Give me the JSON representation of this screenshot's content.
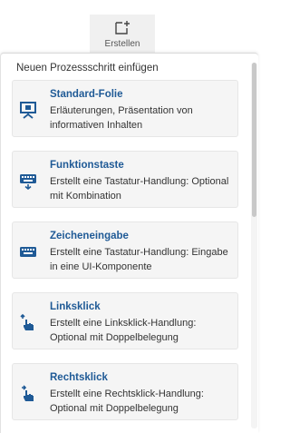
{
  "toolbar": {
    "create_label": "Erstellen",
    "create_icon": "add-slide-icon"
  },
  "panel": {
    "title": "Neuen Prozessschritt einfügen",
    "accent_color": "#1f5a96",
    "items": [
      {
        "title": "Standard-Folie",
        "description": "Erläuterungen, Präsentation von informativen Inhalten",
        "icon": "presentation-icon"
      },
      {
        "title": "Funktionstaste",
        "description": "Erstellt eine Tastatur-Handlung: Optional mit Kombination",
        "icon": "keyboard-key-icon"
      },
      {
        "title": "Zeicheneingabe",
        "description": "Erstellt eine Tastatur-Handlung: Eingabe in eine UI-Komponente",
        "icon": "keyboard-icon"
      },
      {
        "title": "Linksklick",
        "description": "Erstellt eine Linksklick-Handlung: Optional mit Doppelbelegung",
        "icon": "left-click-hand-icon"
      },
      {
        "title": "Rechtsklick",
        "description": "Erstellt eine Rechtsklick-Handlung: Optional mit Doppelbelegung",
        "icon": "right-click-hand-icon"
      }
    ]
  }
}
